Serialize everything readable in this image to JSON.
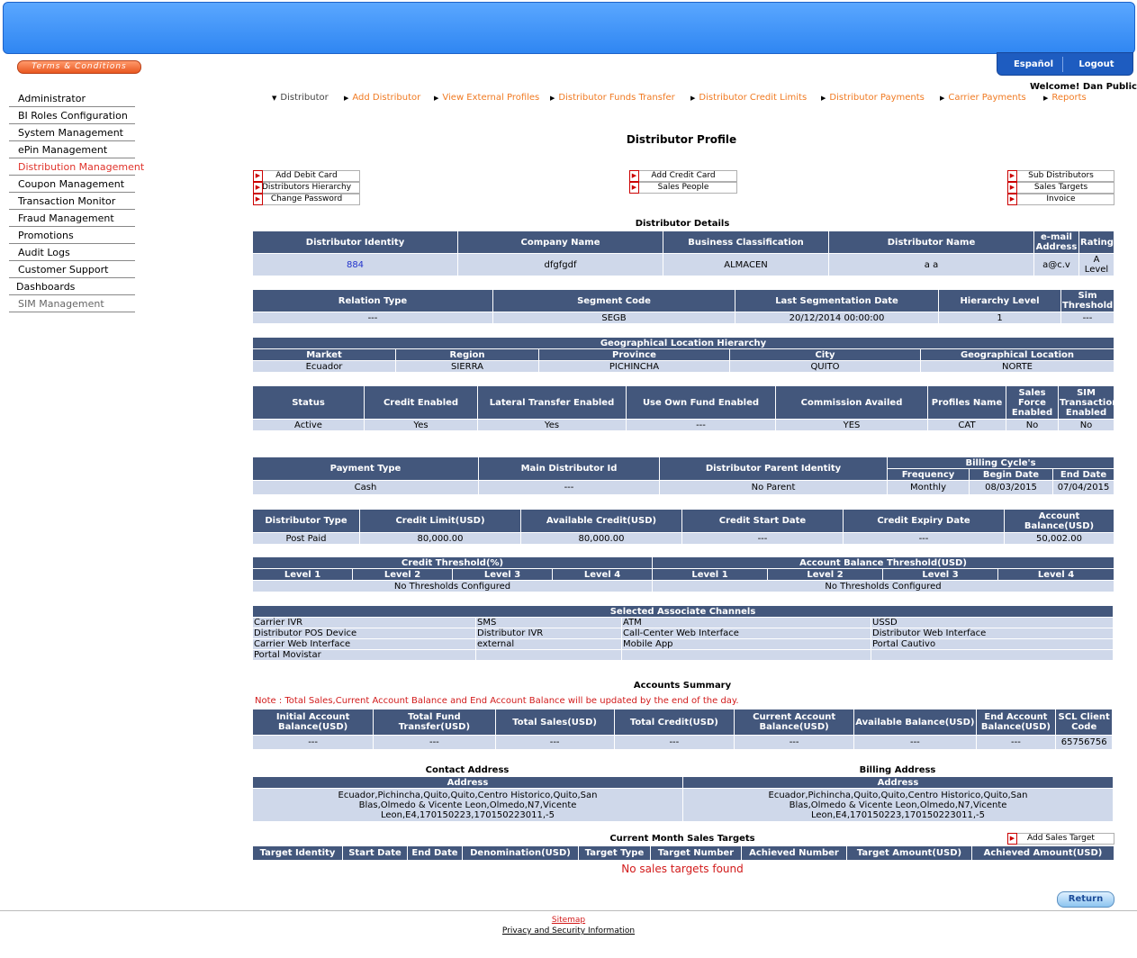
{
  "header": {
    "terms_label": "Terms & Conditions",
    "espanol_label": "Español",
    "logout_label": "Logout",
    "welcome": "Welcome! Dan Public"
  },
  "nav": [
    "Administrator",
    "BI Roles Configuration",
    "System Management",
    "ePin Management",
    "Distribution Management",
    "Coupon Management",
    "Transaction Monitor",
    "Fraud Management",
    "Promotions",
    "Audit Logs",
    "Customer Support",
    "Dashboards",
    "SIM Management"
  ],
  "breadcrumbs": [
    "Distributor",
    "Add Distributor",
    "View External Profiles",
    "Distributor Funds Transfer",
    "Distributor Credit Limits",
    "Distributor Payments",
    "Carrier Payments",
    "Reports"
  ],
  "page_title": "Distributor Profile",
  "actions": {
    "left": [
      "Add Debit Card",
      "Distributors Hierarchy",
      "Change Password"
    ],
    "center": [
      "Add Credit Card",
      "Sales People"
    ],
    "right": [
      "Sub Distributors",
      "Sales Targets",
      "Invoice"
    ]
  },
  "details": {
    "title": "Distributor Details",
    "headers": [
      "Distributor Identity",
      "Company Name",
      "Business Classification",
      "Distributor Name",
      "e-mail Address",
      "Rating"
    ],
    "row": [
      "884",
      "dfgfgdf",
      "ALMACEN",
      "a a",
      "a@c.v",
      "A Level"
    ]
  },
  "relation": {
    "headers": [
      "Relation Type",
      "Segment Code",
      "Last Segmentation Date",
      "Hierarchy Level",
      "Sim Threshold"
    ],
    "row": [
      "---",
      "SEGB",
      "20/12/2014 00:00:00",
      "1",
      "---"
    ]
  },
  "geo": {
    "title": "Geographical Location Hierarchy",
    "headers": [
      "Market",
      "Region",
      "Province",
      "City",
      "Geographical Location"
    ],
    "row": [
      "Ecuador",
      "SIERRA",
      "PICHINCHA",
      "QUITO",
      "NORTE"
    ]
  },
  "status": {
    "headers": [
      "Status",
      "Credit Enabled",
      "Lateral Transfer Enabled",
      "Use Own Fund Enabled",
      "Commission Availed",
      "Profiles Name",
      "Sales Force Enabled",
      "SIM Transactions Enabled"
    ],
    "row": [
      "Active",
      "Yes",
      "Yes",
      "---",
      "YES",
      "CAT",
      "No",
      "No"
    ]
  },
  "payment": {
    "headers": [
      "Payment Type",
      "Main Distributor Id",
      "Distributor Parent Identity"
    ],
    "billing_title": "Billing Cycle's",
    "billing_headers": [
      "Frequency",
      "Begin Date",
      "End Date"
    ],
    "row": [
      "Cash",
      "---",
      "No Parent"
    ],
    "billing_row": [
      "Monthly",
      "08/03/2015",
      "07/04/2015"
    ]
  },
  "credit": {
    "headers": [
      "Distributor Type",
      "Credit Limit(USD)",
      "Available Credit(USD)",
      "Credit Start Date",
      "Credit Expiry Date",
      "Account Balance(USD)"
    ],
    "row": [
      "Post Paid",
      "80,000.00",
      "80,000.00",
      "---",
      "---",
      "50,002.00"
    ]
  },
  "thresholds": {
    "credit_title": "Credit Threshold(%)",
    "balance_title": "Account Balance Threshold(USD)",
    "levels": [
      "Level 1",
      "Level 2",
      "Level 3",
      "Level 4"
    ],
    "empty": "No Thresholds Configured"
  },
  "channels": {
    "title": "Selected Associate Channels",
    "rows": [
      [
        "Carrier IVR",
        "SMS",
        "ATM",
        "USSD"
      ],
      [
        "Distributor POS Device",
        "Distributor IVR",
        "Call-Center Web Interface",
        "Distributor Web Interface"
      ],
      [
        "Carrier Web Interface",
        "external",
        "Mobile App",
        "Portal Cautivo"
      ],
      [
        "Portal Movistar",
        "",
        "",
        ""
      ]
    ]
  },
  "accounts": {
    "title": "Accounts Summary",
    "note": "Note : Total Sales,Current Account Balance and End Account Balance will be updated by the end of the day.",
    "headers": [
      "Initial Account Balance(USD)",
      "Total Fund Transfer(USD)",
      "Total Sales(USD)",
      "Total Credit(USD)",
      "Current Account Balance(USD)",
      "Available Balance(USD)",
      "End Account Balance(USD)",
      "SCL Client Code"
    ],
    "row": [
      "---",
      "---",
      "---",
      "---",
      "---",
      "---",
      "---",
      "65756756"
    ]
  },
  "address": {
    "contact_title": "Contact Address",
    "billing_title": "Billing Address",
    "col_header": "Address",
    "contact": "Ecuador,Pichincha,Quito,Quito,Centro Historico,Quito,San Blas,Olmedo & Vicente Leon,Olmedo,N7,Vicente Leon,E4,170150223,170150223011,-5",
    "billing": "Ecuador,Pichincha,Quito,Quito,Centro Historico,Quito,San Blas,Olmedo & Vicente Leon,Olmedo,N7,Vicente Leon,E4,170150223,170150223011,-5"
  },
  "targets": {
    "title": "Current Month Sales Targets",
    "add_label": "Add Sales Target",
    "headers": [
      "Target Identity",
      "Start Date",
      "End Date",
      "Denomination(USD)",
      "Target Type",
      "Target Number",
      "Achieved Number",
      "Target Amount(USD)",
      "Achieved Amount(USD)"
    ],
    "empty": "No sales targets found"
  },
  "return_label": "Return",
  "footer": {
    "sitemap": "Sitemap",
    "privacy": "Privacy and Security Information"
  }
}
